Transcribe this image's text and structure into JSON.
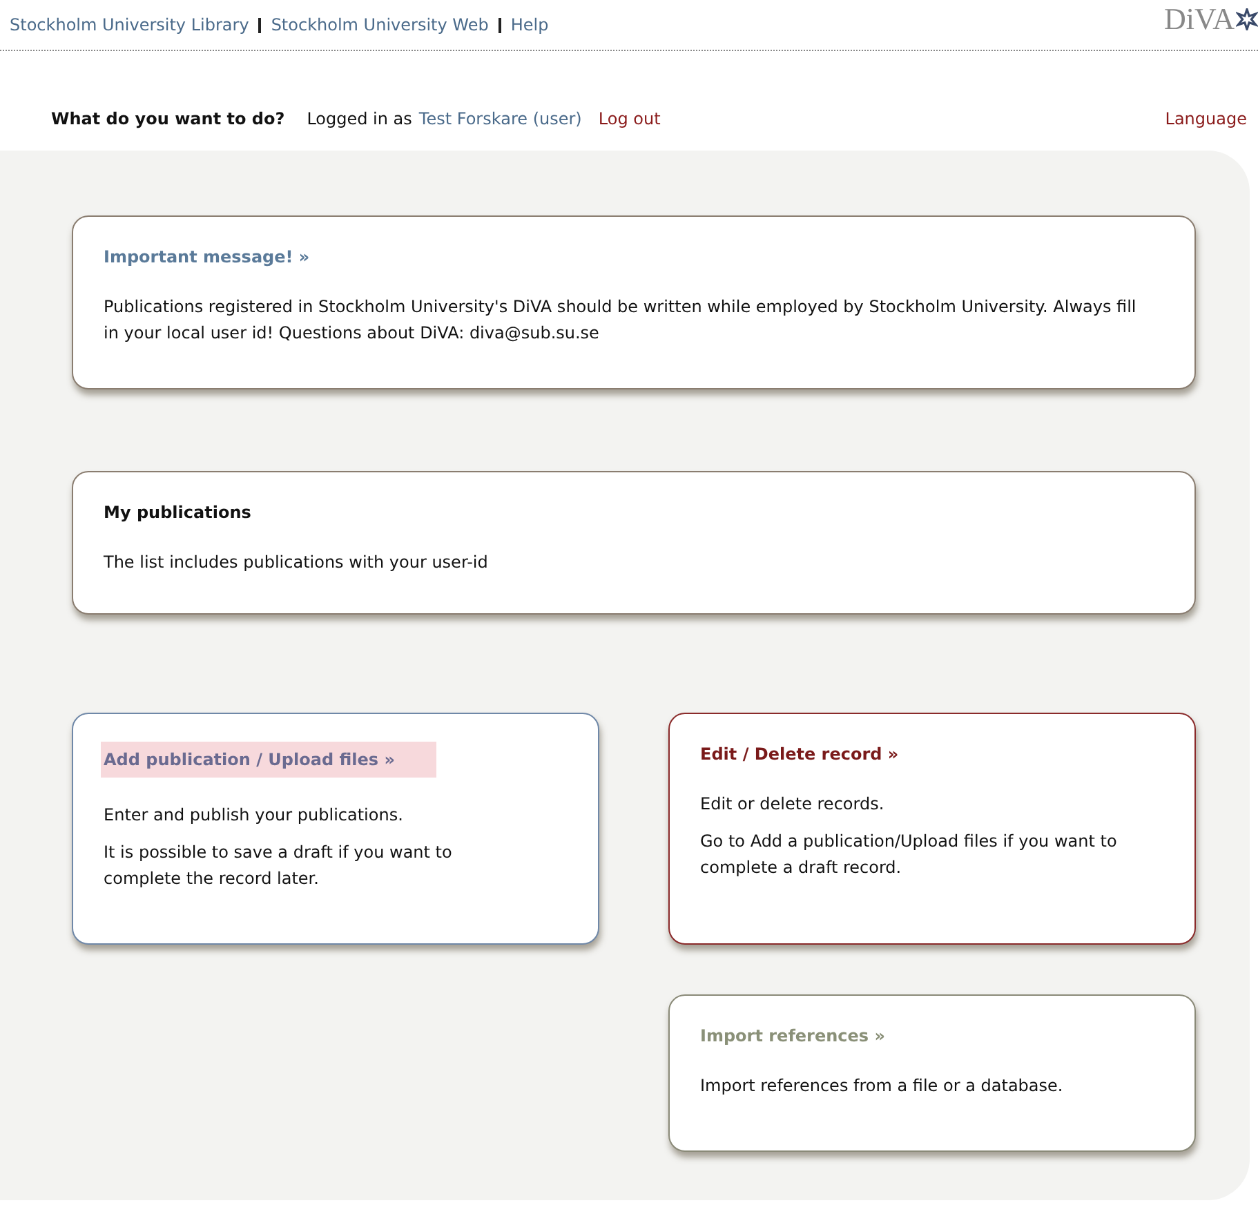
{
  "top_links": [
    "Stockholm University Library",
    "Stockholm University Web",
    "Help"
  ],
  "logo": {
    "text": "DiVA"
  },
  "toolbar": {
    "heading": "What do you want to do?",
    "logged_in_label": "Logged in as",
    "user": "Test Forskare (user)",
    "logout": "Log out",
    "language": "Language"
  },
  "cards": [
    {
      "title": "Important message! »",
      "color": "#5a7a99",
      "highlighted": false,
      "paragraphs": [
        "Publications registered in Stockholm University's DiVA should be written while employed by Stockholm University. Always fill in your local user id! Questions about DiVA: diva@sub.su.se"
      ]
    },
    {
      "title": "My publications",
      "color": "#111111",
      "highlighted": false,
      "paragraphs": [
        "The list includes publications with your user-id"
      ]
    },
    {
      "title": "Add publication / Upload files »",
      "color": "#6a6a90",
      "highlighted": true,
      "paragraphs": [
        "Enter and publish your publications.",
        "It is possible to save a draft if you want to complete the record later."
      ]
    },
    {
      "title": "Edit / Delete record »",
      "color": "#7a1a1a",
      "highlighted": false,
      "paragraphs": [
        "Edit or delete records.",
        "Go to Add a publication/Upload files if you want to complete a draft record."
      ]
    },
    {
      "title": "Import references »",
      "color": "#8a9078",
      "highlighted": false,
      "paragraphs": [
        "Import references from a file or a database."
      ]
    }
  ]
}
